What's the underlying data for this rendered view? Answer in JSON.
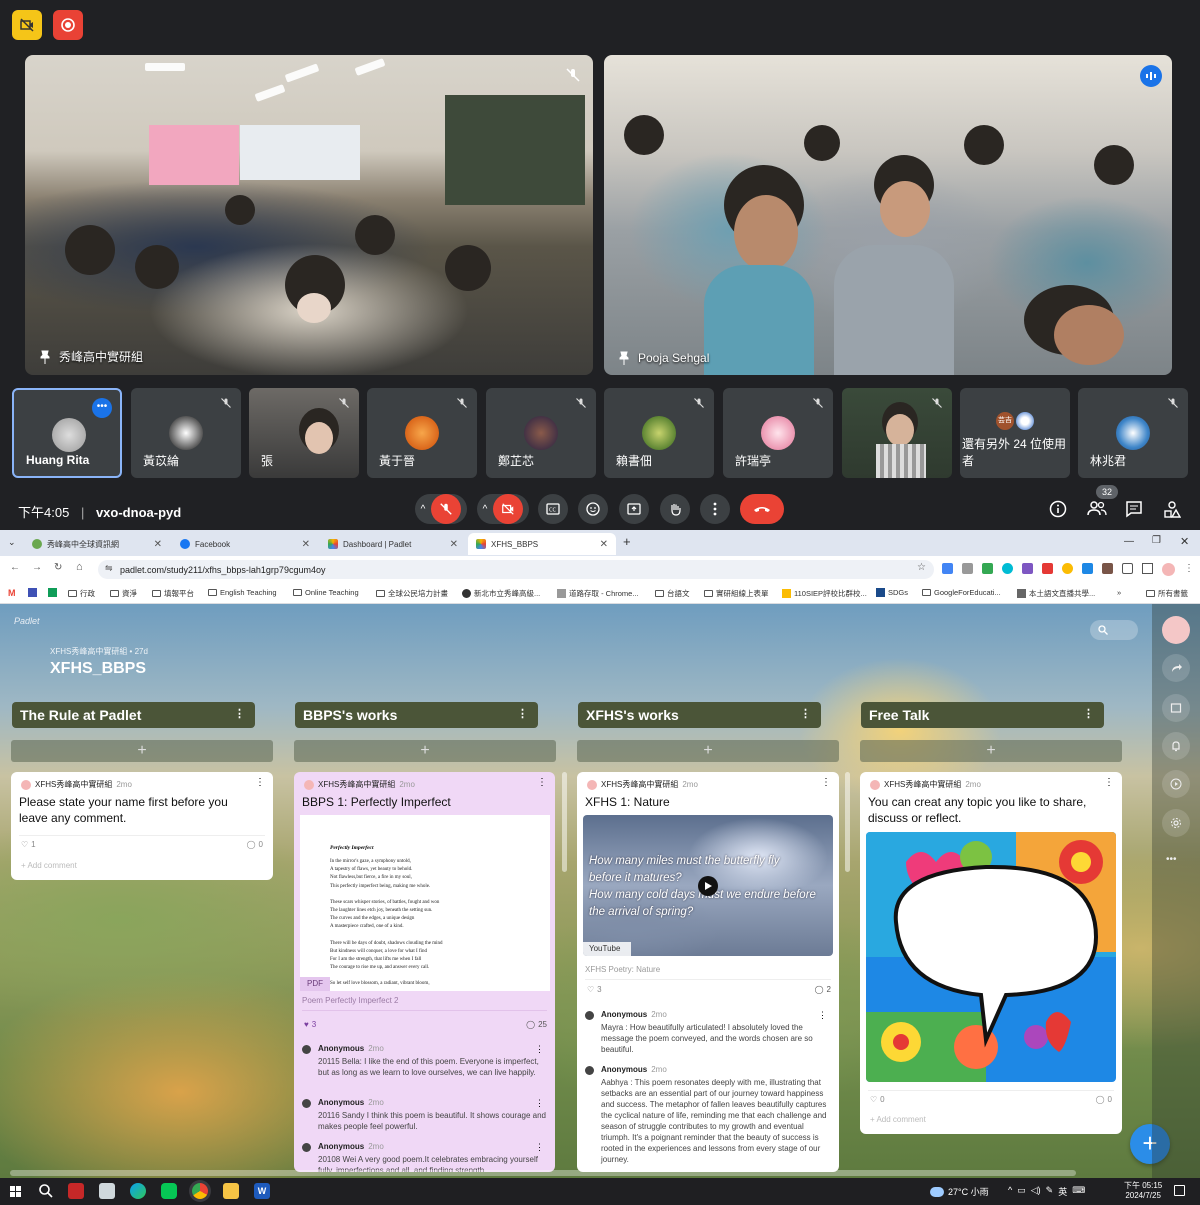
{
  "meet": {
    "main_tiles": [
      {
        "name": "秀峰高中實研組"
      },
      {
        "name": "Pooja Sehgal"
      }
    ],
    "participants": [
      {
        "name": "Huang Rita"
      },
      {
        "name": "黃苡綸"
      },
      {
        "name": "張"
      },
      {
        "name": "黃于晉"
      },
      {
        "name": "鄭芷芯"
      },
      {
        "name": "賴書佃"
      },
      {
        "name": "許瑞亭"
      },
      {
        "name": ""
      },
      {
        "name": "還有另外 24 位使用者",
        "badge": "芸吉"
      },
      {
        "name": "林兆君"
      }
    ],
    "time": "下午4:05",
    "meeting_code": "vxo-dnoa-pyd",
    "people_count": "32"
  },
  "browser": {
    "tabs": [
      {
        "label": "秀峰高中全球資訊網"
      },
      {
        "label": "Facebook"
      },
      {
        "label": "Dashboard | Padlet"
      },
      {
        "label": "XFHS_BBPS"
      }
    ],
    "new_tab": "+",
    "url": "padlet.com/study211/xfhs_bbps-lah1grp79cgum4oy",
    "bookmarks": [
      "M",
      "行政",
      "資淨",
      "填報平台",
      "English Teaching",
      "Online Teaching",
      "全球公民培力計畫",
      "新北市立秀峰高級...",
      "道路存取 - Chrome...",
      "台語文",
      "實研組線上表單",
      "110SIEP評校比群校...",
      "SDGs",
      "GoogleForEducati...",
      "本土語文直播共學...",
      "»",
      "所有書籤"
    ]
  },
  "padlet": {
    "brand": "Padlet",
    "subtitle": "XFHS秀峰高中實研組 • 27d",
    "title": "XFHS_BBPS",
    "columns": [
      {
        "title": "The Rule at Padlet"
      },
      {
        "title": "BBPS's works"
      },
      {
        "title": "XFHS's works"
      },
      {
        "title": "Free Talk"
      }
    ],
    "add_symbol": "+",
    "more_symbol": "⋮",
    "author_name": "XFHS秀峰高中實研組",
    "ago": "2mo",
    "card1": {
      "text": "Please state your name first before you leave any comment.",
      "likes": "1",
      "comments": "0",
      "add_comment": "Add comment"
    },
    "card2": {
      "title": "BBPS 1: Perfectly Imperfect",
      "doc_title": "Perfectly Imperfect",
      "doc_lines": [
        "In the mirror's gaze, a symphony untold,",
        "A tapestry of flaws, yet beauty to behold.",
        "Not flawless,but fierce, a fire in my soul,",
        "This perfectly imperfect being, making me whole.",
        "",
        "These scars whisper stories, of battles, fought and won",
        "The laughter lines etch joy, beneath the setting sun.",
        "The curves and the edges, a unique design",
        "A masterpiece crafted, one of a kind.",
        "",
        "There will be days of doubt, shadows clouding the mind",
        "But kindness will conquer, a love for what I find",
        "For I am the strength, that lifts me when I fall",
        "The courage to rise me up, and answer every call.",
        "",
        "So let self love blossom, a radiant, vibrant bloom,"
      ],
      "pdf": "PDF",
      "caption": "Poem Perfectly Imperfect 2",
      "likes": "3",
      "comments": "25",
      "replies": [
        {
          "name": "Anonymous",
          "ago": "2mo",
          "text": "20115 Bella:  I like the end of this poem. Everyone is imperfect, but as long as we learn to love ourselves, we can live happily."
        },
        {
          "name": "Anonymous",
          "ago": "2mo",
          "text": "20116 Sandy I think this poem is beautiful. It shows courage and makes people feel powerful."
        },
        {
          "name": "Anonymous",
          "ago": "2mo",
          "text": "20108 Wei   A very good poem.It celebrates embracing yourself fully, imperfections and all, and finding strength"
        }
      ]
    },
    "card3": {
      "title": "XFHS 1: Nature",
      "video_lines": [
        "How many miles must the butterfly fly",
        "before it matures?",
        "How many cold days must we endure before",
        "the arrival of spring?"
      ],
      "youtube": "YouTube",
      "caption": "XFHS Poetry: Nature",
      "likes": "3",
      "comments": "2",
      "replies": [
        {
          "name": "Anonymous",
          "ago": "2mo",
          "text": "Mayra : How beautifully articulated! I absolutely loved the message the poem conveyed, and the words chosen are so beautiful."
        },
        {
          "name": "Anonymous",
          "ago": "2mo",
          "text": "Aabhya : This poem resonates deeply with me, illustrating that setbacks are an essential part of our journey toward happiness and success. The metaphor of fallen leaves beautifully captures the cyclical nature of life, reminding me that each challenge and season of struggle contributes to my growth and eventual triumph. It's a poignant reminder that the beauty of success is rooted in the experiences and lessons from every stage of our journey."
        }
      ]
    },
    "card4": {
      "text": "You can creat any topic you like to share, discuss or reflect.",
      "likes": "0",
      "comments": "0",
      "add_comment": "Add comment"
    },
    "fab": "+",
    "side_more": "•••"
  },
  "taskbar": {
    "weather": "27°C 小雨",
    "ime": "英",
    "time": "下午 05:15",
    "date": "2024/7/25"
  }
}
